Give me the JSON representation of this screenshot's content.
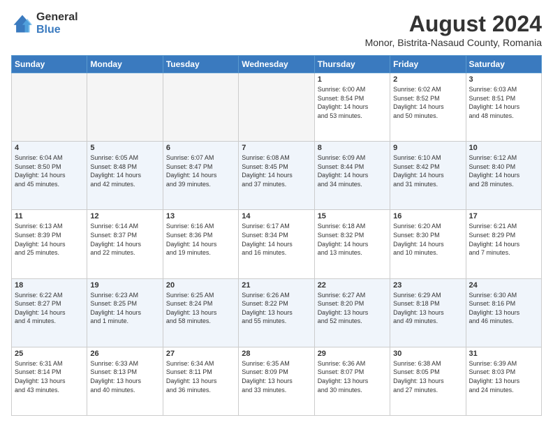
{
  "logo": {
    "general": "General",
    "blue": "Blue"
  },
  "title": "August 2024",
  "subtitle": "Monor, Bistrita-Nasaud County, Romania",
  "days_of_week": [
    "Sunday",
    "Monday",
    "Tuesday",
    "Wednesday",
    "Thursday",
    "Friday",
    "Saturday"
  ],
  "weeks": [
    [
      {
        "day": "",
        "info": ""
      },
      {
        "day": "",
        "info": ""
      },
      {
        "day": "",
        "info": ""
      },
      {
        "day": "",
        "info": ""
      },
      {
        "day": "1",
        "info": "Sunrise: 6:00 AM\nSunset: 8:54 PM\nDaylight: 14 hours\nand 53 minutes."
      },
      {
        "day": "2",
        "info": "Sunrise: 6:02 AM\nSunset: 8:52 PM\nDaylight: 14 hours\nand 50 minutes."
      },
      {
        "day": "3",
        "info": "Sunrise: 6:03 AM\nSunset: 8:51 PM\nDaylight: 14 hours\nand 48 minutes."
      }
    ],
    [
      {
        "day": "4",
        "info": "Sunrise: 6:04 AM\nSunset: 8:50 PM\nDaylight: 14 hours\nand 45 minutes."
      },
      {
        "day": "5",
        "info": "Sunrise: 6:05 AM\nSunset: 8:48 PM\nDaylight: 14 hours\nand 42 minutes."
      },
      {
        "day": "6",
        "info": "Sunrise: 6:07 AM\nSunset: 8:47 PM\nDaylight: 14 hours\nand 39 minutes."
      },
      {
        "day": "7",
        "info": "Sunrise: 6:08 AM\nSunset: 8:45 PM\nDaylight: 14 hours\nand 37 minutes."
      },
      {
        "day": "8",
        "info": "Sunrise: 6:09 AM\nSunset: 8:44 PM\nDaylight: 14 hours\nand 34 minutes."
      },
      {
        "day": "9",
        "info": "Sunrise: 6:10 AM\nSunset: 8:42 PM\nDaylight: 14 hours\nand 31 minutes."
      },
      {
        "day": "10",
        "info": "Sunrise: 6:12 AM\nSunset: 8:40 PM\nDaylight: 14 hours\nand 28 minutes."
      }
    ],
    [
      {
        "day": "11",
        "info": "Sunrise: 6:13 AM\nSunset: 8:39 PM\nDaylight: 14 hours\nand 25 minutes."
      },
      {
        "day": "12",
        "info": "Sunrise: 6:14 AM\nSunset: 8:37 PM\nDaylight: 14 hours\nand 22 minutes."
      },
      {
        "day": "13",
        "info": "Sunrise: 6:16 AM\nSunset: 8:36 PM\nDaylight: 14 hours\nand 19 minutes."
      },
      {
        "day": "14",
        "info": "Sunrise: 6:17 AM\nSunset: 8:34 PM\nDaylight: 14 hours\nand 16 minutes."
      },
      {
        "day": "15",
        "info": "Sunrise: 6:18 AM\nSunset: 8:32 PM\nDaylight: 14 hours\nand 13 minutes."
      },
      {
        "day": "16",
        "info": "Sunrise: 6:20 AM\nSunset: 8:30 PM\nDaylight: 14 hours\nand 10 minutes."
      },
      {
        "day": "17",
        "info": "Sunrise: 6:21 AM\nSunset: 8:29 PM\nDaylight: 14 hours\nand 7 minutes."
      }
    ],
    [
      {
        "day": "18",
        "info": "Sunrise: 6:22 AM\nSunset: 8:27 PM\nDaylight: 14 hours\nand 4 minutes."
      },
      {
        "day": "19",
        "info": "Sunrise: 6:23 AM\nSunset: 8:25 PM\nDaylight: 14 hours\nand 1 minute."
      },
      {
        "day": "20",
        "info": "Sunrise: 6:25 AM\nSunset: 8:24 PM\nDaylight: 13 hours\nand 58 minutes."
      },
      {
        "day": "21",
        "info": "Sunrise: 6:26 AM\nSunset: 8:22 PM\nDaylight: 13 hours\nand 55 minutes."
      },
      {
        "day": "22",
        "info": "Sunrise: 6:27 AM\nSunset: 8:20 PM\nDaylight: 13 hours\nand 52 minutes."
      },
      {
        "day": "23",
        "info": "Sunrise: 6:29 AM\nSunset: 8:18 PM\nDaylight: 13 hours\nand 49 minutes."
      },
      {
        "day": "24",
        "info": "Sunrise: 6:30 AM\nSunset: 8:16 PM\nDaylight: 13 hours\nand 46 minutes."
      }
    ],
    [
      {
        "day": "25",
        "info": "Sunrise: 6:31 AM\nSunset: 8:14 PM\nDaylight: 13 hours\nand 43 minutes."
      },
      {
        "day": "26",
        "info": "Sunrise: 6:33 AM\nSunset: 8:13 PM\nDaylight: 13 hours\nand 40 minutes."
      },
      {
        "day": "27",
        "info": "Sunrise: 6:34 AM\nSunset: 8:11 PM\nDaylight: 13 hours\nand 36 minutes."
      },
      {
        "day": "28",
        "info": "Sunrise: 6:35 AM\nSunset: 8:09 PM\nDaylight: 13 hours\nand 33 minutes."
      },
      {
        "day": "29",
        "info": "Sunrise: 6:36 AM\nSunset: 8:07 PM\nDaylight: 13 hours\nand 30 minutes."
      },
      {
        "day": "30",
        "info": "Sunrise: 6:38 AM\nSunset: 8:05 PM\nDaylight: 13 hours\nand 27 minutes."
      },
      {
        "day": "31",
        "info": "Sunrise: 6:39 AM\nSunset: 8:03 PM\nDaylight: 13 hours\nand 24 minutes."
      }
    ]
  ]
}
